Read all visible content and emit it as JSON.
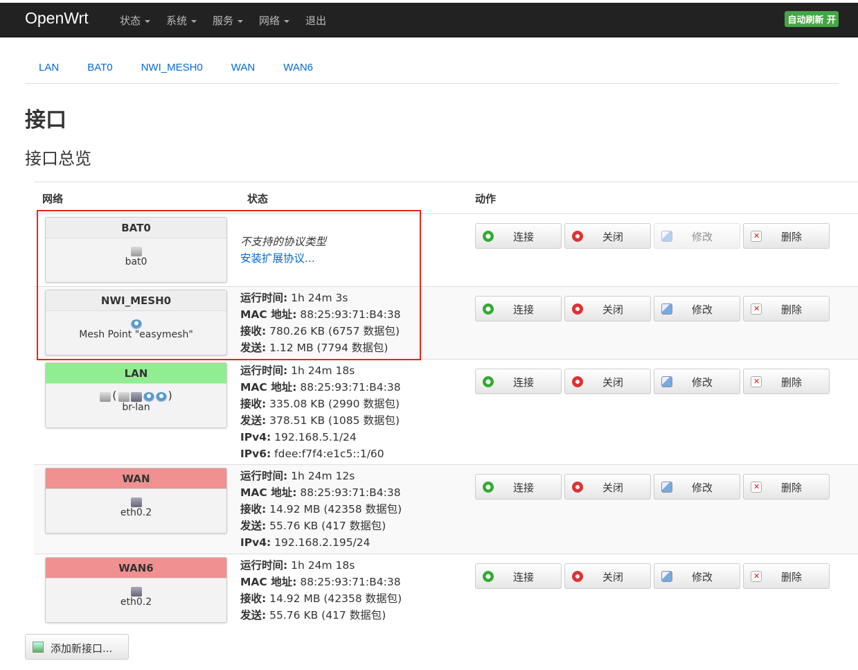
{
  "navbar": {
    "brand": "OpenWrt",
    "menu": [
      {
        "label": "状态"
      },
      {
        "label": "系统"
      },
      {
        "label": "服务"
      },
      {
        "label": "网络"
      },
      {
        "label": "退出"
      }
    ],
    "autorefresh": "自动刷新 开"
  },
  "tabs": [
    "LAN",
    "BAT0",
    "NWI_MESH0",
    "WAN",
    "WAN6"
  ],
  "page_title": "接口",
  "section_title": "接口总览",
  "table": {
    "headers": {
      "network": "网络",
      "status": "状态",
      "actions": "动作"
    },
    "rows": [
      {
        "name": "BAT0",
        "color": "#eeeeee",
        "device": "bat0",
        "unsupported": "不支持的协议类型",
        "install": "安装扩展协议..."
      },
      {
        "name": "NWI_MESH0",
        "color": "#eeeeee",
        "device": "Mesh Point \"easymesh\"",
        "uptime_label": "运行时间:",
        "uptime": "1h 24m 3s",
        "mac_label": "MAC 地址:",
        "mac": "88:25:93:71:B4:38",
        "rx_label": "接收:",
        "rx": "780.26 KB (6757 数据包)",
        "tx_label": "发送:",
        "tx": "1.12 MB (7794 数据包)"
      },
      {
        "name": "LAN",
        "color": "#90ee90",
        "device": "br-lan",
        "bracket_open": "(",
        "bracket_close": ")",
        "uptime_label": "运行时间:",
        "uptime": "1h 24m 18s",
        "mac_label": "MAC 地址:",
        "mac": "88:25:93:71:B4:38",
        "rx_label": "接收:",
        "rx": "335.08 KB (2990 数据包)",
        "tx_label": "发送:",
        "tx": "378.51 KB (1085 数据包)",
        "ipv4_label": "IPv4:",
        "ipv4": "192.168.5.1/24",
        "ipv6_label": "IPv6:",
        "ipv6": "fdee:f7f4:e1c5::1/60"
      },
      {
        "name": "WAN",
        "color": "#f09090",
        "device": "eth0.2",
        "uptime_label": "运行时间:",
        "uptime": "1h 24m 12s",
        "mac_label": "MAC 地址:",
        "mac": "88:25:93:71:B4:38",
        "rx_label": "接收:",
        "rx": "14.92 MB (42358 数据包)",
        "tx_label": "发送:",
        "tx": "55.76 KB (417 数据包)",
        "ipv4_label": "IPv4:",
        "ipv4": "192.168.2.195/24"
      },
      {
        "name": "WAN6",
        "color": "#f09090",
        "device": "eth0.2",
        "uptime_label": "运行时间:",
        "uptime": "1h 24m 18s",
        "mac_label": "MAC 地址:",
        "mac": "88:25:93:71:B4:38",
        "rx_label": "接收:",
        "rx": "14.92 MB (42358 数据包)",
        "tx_label": "发送:",
        "tx": "55.76 KB (417 数据包)"
      }
    ]
  },
  "buttons": {
    "connect": "连接",
    "stop": "关闭",
    "edit": "修改",
    "delete": "删除"
  },
  "add_interface": "添加新接口..."
}
